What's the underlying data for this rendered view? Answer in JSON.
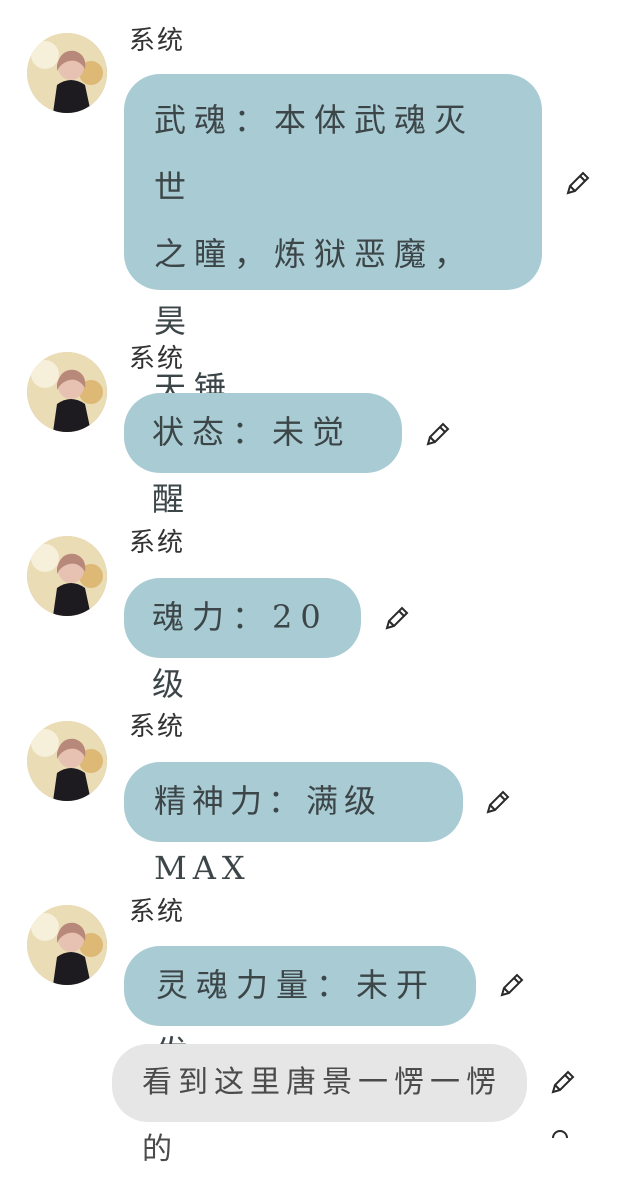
{
  "messages": [
    {
      "sender": "系统",
      "text": "武魂：本体武魂灭世之瞳，炼狱恶魔，昊天锤",
      "line1": "武魂：本体武魂灭世",
      "line2": "之瞳，炼狱恶魔，昊",
      "line3": "天锤"
    },
    {
      "sender": "系统",
      "text": "状态：未觉醒"
    },
    {
      "sender": "系统",
      "text": "魂力：20级"
    },
    {
      "sender": "系统",
      "text": "精神力：满级MAX"
    },
    {
      "sender": "系统",
      "text": "灵魂力量：未开发"
    }
  ],
  "narration": {
    "text": "看到这里唐景一愣一愣的"
  },
  "icons": {
    "edit": "pencil-icon",
    "avatar": "avatar-image"
  },
  "colors": {
    "bubble": "#a9cbd3",
    "narration_bubble": "#e6e6e6",
    "text": "#3c4648"
  }
}
